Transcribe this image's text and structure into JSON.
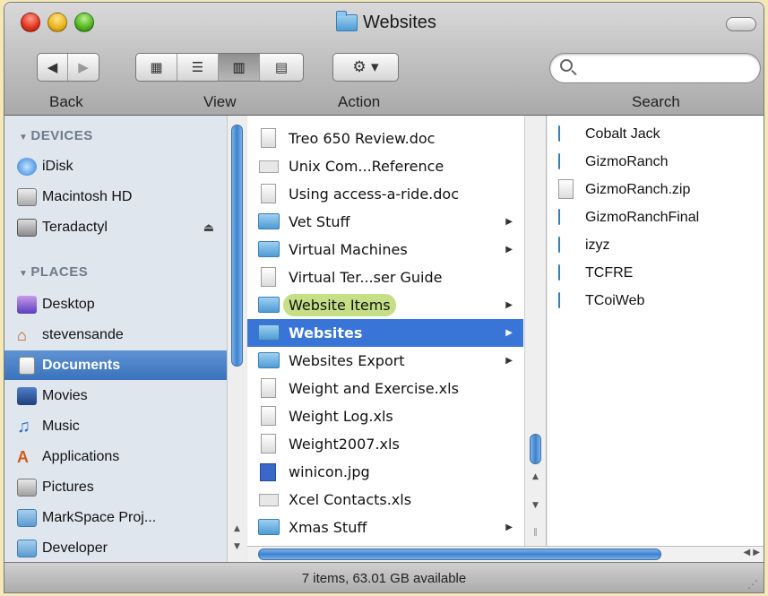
{
  "window": {
    "title": "Websites"
  },
  "toolbar": {
    "back_label": "Back",
    "view_label": "View",
    "action_label": "Action",
    "search_label": "Search",
    "search_value": "",
    "view_buttons": [
      "icon-view",
      "list-view",
      "column-view",
      "coverflow-view"
    ],
    "active_view": "column-view"
  },
  "sidebar": {
    "devices_header": "DEVICES",
    "places_header": "PLACES",
    "devices": [
      {
        "label": "iDisk",
        "icon": "idisk-icon"
      },
      {
        "label": "Macintosh HD",
        "icon": "hard-drive-icon"
      },
      {
        "label": "Teradactyl",
        "icon": "external-drive-icon",
        "eject": true
      }
    ],
    "places": [
      {
        "label": "Desktop",
        "icon": "desktop-icon"
      },
      {
        "label": "stevensande",
        "icon": "home-icon"
      },
      {
        "label": "Documents",
        "icon": "documents-icon",
        "selected": true
      },
      {
        "label": "Movies",
        "icon": "movies-icon"
      },
      {
        "label": "Music",
        "icon": "music-icon"
      },
      {
        "label": "Applications",
        "icon": "applications-icon"
      },
      {
        "label": "Pictures",
        "icon": "pictures-icon"
      },
      {
        "label": "MarkSpace Proj...",
        "icon": "folder-icon"
      },
      {
        "label": "Developer",
        "icon": "folder-icon"
      }
    ]
  },
  "column_documents": [
    {
      "label": "Treo 650 Review.doc",
      "kind": "doc"
    },
    {
      "label": "Unix Com...Reference",
      "kind": "wide"
    },
    {
      "label": "Using access-a-ride.doc",
      "kind": "doc"
    },
    {
      "label": "Vet Stuff",
      "kind": "folder",
      "has_children": true
    },
    {
      "label": "Virtual Machines",
      "kind": "folder",
      "has_children": true
    },
    {
      "label": "Virtual Ter...ser Guide",
      "kind": "doc"
    },
    {
      "label": "Website Items",
      "kind": "folder",
      "has_children": true,
      "color_label": "green"
    },
    {
      "label": "Websites",
      "kind": "folder",
      "has_children": true,
      "selected": true
    },
    {
      "label": "Websites Export",
      "kind": "folder",
      "has_children": true
    },
    {
      "label": "Weight and Exercise.xls",
      "kind": "doc"
    },
    {
      "label": "Weight Log.xls",
      "kind": "doc"
    },
    {
      "label": "Weight2007.xls",
      "kind": "doc"
    },
    {
      "label": "winicon.jpg",
      "kind": "img"
    },
    {
      "label": "Xcel Contacts.xls",
      "kind": "wide"
    },
    {
      "label": "Xmas Stuff",
      "kind": "folder",
      "has_children": true
    }
  ],
  "column_websites": [
    {
      "label": "Cobalt Jack",
      "kind": "folder"
    },
    {
      "label": "GizmoRanch",
      "kind": "folder"
    },
    {
      "label": "GizmoRanch.zip",
      "kind": "zip"
    },
    {
      "label": "GizmoRanchFinal",
      "kind": "folder"
    },
    {
      "label": "izyz",
      "kind": "folder"
    },
    {
      "label": "TCFRE",
      "kind": "folder"
    },
    {
      "label": "TCoiWeb",
      "kind": "folder"
    }
  ],
  "status": {
    "text": "7 items, 63.01 GB available"
  },
  "colors": {
    "selection": "#3875d7",
    "sidebar_selection": "#3a73bc",
    "green_label": "#c5df86",
    "sidebar_bg": "#e0e6ee"
  }
}
